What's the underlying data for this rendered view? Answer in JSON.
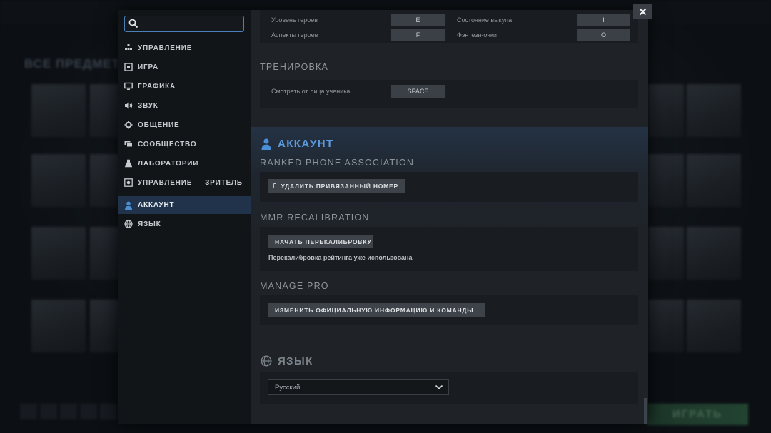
{
  "background": {
    "heading": "ВСЕ ПРЕДМЕТЫ",
    "play_label": "ИГРАТЬ"
  },
  "search": {
    "value": "",
    "placeholder": ""
  },
  "sidebar": {
    "items": [
      {
        "label": "УПРАВЛЕНИЕ",
        "icon": "controls-icon"
      },
      {
        "label": "ИГРА",
        "icon": "game-icon"
      },
      {
        "label": "ГРАФИКА",
        "icon": "monitor-icon"
      },
      {
        "label": "ЗВУК",
        "icon": "speaker-icon"
      },
      {
        "label": "ОБЩЕНИЕ",
        "icon": "gear-icon"
      },
      {
        "label": "СООБЩЕСТВО",
        "icon": "chat-icon"
      },
      {
        "label": "ЛАБОРАТОРИИ",
        "icon": "flask-icon"
      },
      {
        "label": "УПРАВЛЕНИЕ — ЗРИТЕЛЬ",
        "icon": "spectator-icon"
      },
      {
        "label": "АККАУНТ",
        "icon": "user-icon",
        "active": true
      },
      {
        "label": "ЯЗЫК",
        "icon": "globe-icon"
      }
    ]
  },
  "keybinds": {
    "row1_left_label": "Уровень героев",
    "row1_left_key": "E",
    "row1_right_label": "Состояние выкупа",
    "row1_right_key": "I",
    "row2_left_label": "Аспекты героев",
    "row2_left_key": "F",
    "row2_right_label": "Фэнтези-очки",
    "row2_right_key": "O"
  },
  "training": {
    "title": "ТРЕНИРОВКА",
    "label": "Смотреть от лица ученика",
    "key": "SPACE"
  },
  "account": {
    "title": "АККАУНТ",
    "phone_title": "RANKED PHONE ASSOCIATION",
    "phone_button": "УДАЛИТЬ ПРИВЯЗАННЫЙ НОМЕР",
    "mmr_title": "MMR RECALIBRATION",
    "mmr_button": "НАЧАТЬ ПЕРЕКАЛИБРОВКУ",
    "mmr_note": "Перекалибровка рейтинга уже использована",
    "pro_title": "MANAGE PRO",
    "pro_button": "ИЗМЕНИТЬ ОФИЦИАЛЬНУЮ ИНФОРМАЦИЮ И КОМАНДЫ"
  },
  "language": {
    "title": "ЯЗЫК",
    "selected": "Русский"
  },
  "colors": {
    "accent": "#4a8fd6",
    "active_nav": "#20334b",
    "button": "#3d4349"
  }
}
